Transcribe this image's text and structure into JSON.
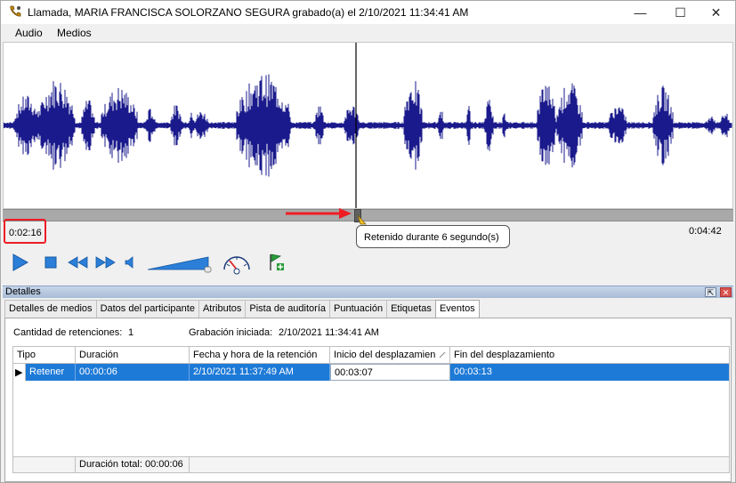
{
  "window": {
    "title": "Llamada, MARIA FRANCISCA SOLORZANO SEGURA grabado(a) el 2/10/2021 11:34:41 AM",
    "min_label": "—",
    "max_label": "☐",
    "close_label": "✕"
  },
  "menu": {
    "audio": "Audio",
    "medios": "Medios"
  },
  "player": {
    "current_time": "0:02:16",
    "total_time": "0:04:42",
    "tooltip": "Retenido durante 6 segundo(s)",
    "position_fraction": 0.483
  },
  "colors": {
    "waveform": "#1a1a8c",
    "accent_highlight": "#ee1c24",
    "selection": "#1e7ad7"
  },
  "details": {
    "title": "Detalles",
    "pin_label": "⇱",
    "close_label": "✕",
    "tabs": [
      "Detalles de medios",
      "Datos del participante",
      "Atributos",
      "Pista de auditoría",
      "Puntuación",
      "Etiquetas",
      "Eventos"
    ],
    "active_tab": "Eventos",
    "summary": {
      "retenciones_label": "Cantidad de retenciones:",
      "retenciones_value": "1",
      "grabacion_label": "Grabación iniciada:",
      "grabacion_value": "2/10/2021 11:34:41 AM"
    },
    "grid": {
      "columns": [
        "Tipo",
        "Duración",
        "Fecha y hora de la retención",
        "Inicio del desplazamien",
        "Fin del desplazamiento"
      ],
      "rows": [
        {
          "marker": "▶",
          "tipo": "Retener",
          "duracion": "00:00:06",
          "fecha": "2/10/2021 11:37:49 AM",
          "inicio": "00:03:07",
          "fin": "00:03:13"
        }
      ],
      "footer": "Duración total: 00:00:06"
    }
  }
}
